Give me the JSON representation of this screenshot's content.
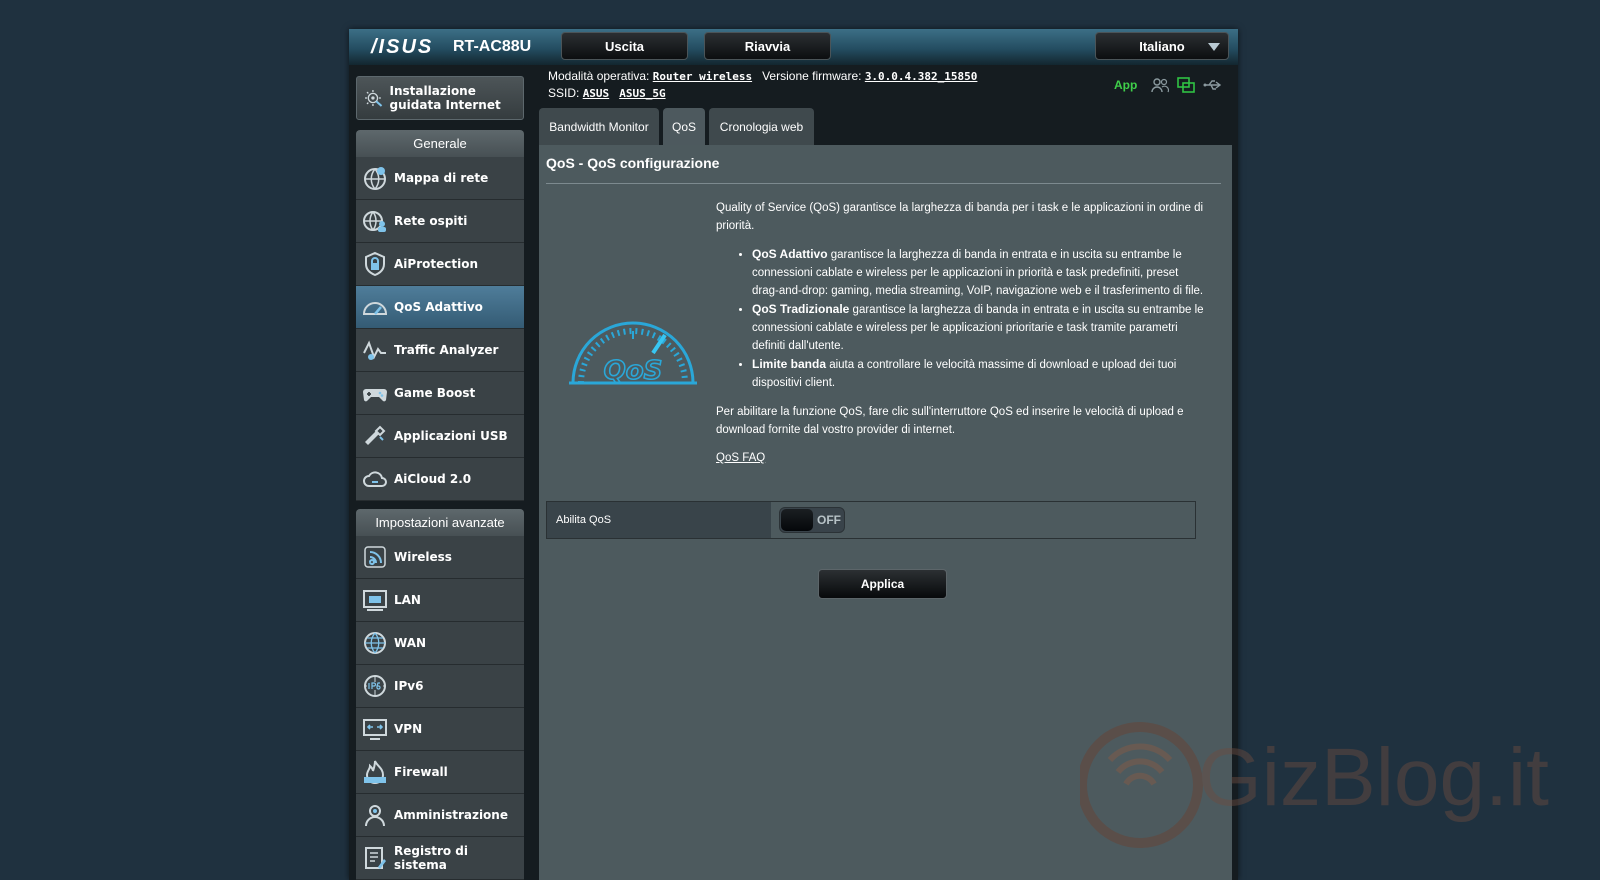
{
  "header": {
    "brand": "/ISUS",
    "model": "RT-AC88U",
    "buttons": {
      "logout": "Uscita",
      "reboot": "Riavvia"
    },
    "language": "Italiano"
  },
  "info": {
    "mode_label": "Modalità operativa:",
    "mode_value": "Router wireless",
    "firmware_label": "Versione firmware:",
    "firmware_value": "3.0.0.4.382_15850",
    "ssid_label": "SSID:",
    "ssid_1": "ASUS",
    "ssid_2": "ASUS_5G",
    "app_label": "App"
  },
  "sidebar": {
    "quick_setup": "Installazione guidata Internet",
    "general_header": "Generale",
    "general_items": [
      {
        "label": "Mappa di rete",
        "icon": "network-map-icon"
      },
      {
        "label": "Rete ospiti",
        "icon": "guest-network-icon"
      },
      {
        "label": "AiProtection",
        "icon": "shield-icon"
      },
      {
        "label": "QoS Adattivo",
        "icon": "speedometer-icon"
      },
      {
        "label": "Traffic Analyzer",
        "icon": "traffic-icon"
      },
      {
        "label": "Game Boost",
        "icon": "gamepad-icon"
      },
      {
        "label": "Applicazioni USB",
        "icon": "usb-icon"
      },
      {
        "label": "AiCloud 2.0",
        "icon": "cloud-icon"
      }
    ],
    "advanced_header": "Impostazioni avanzate",
    "advanced_items": [
      {
        "label": "Wireless",
        "icon": "wifi-icon"
      },
      {
        "label": "LAN",
        "icon": "lan-icon"
      },
      {
        "label": "WAN",
        "icon": "globe-icon"
      },
      {
        "label": "IPv6",
        "icon": "ipv6-icon"
      },
      {
        "label": "VPN",
        "icon": "vpn-icon"
      },
      {
        "label": "Firewall",
        "icon": "firewall-icon"
      },
      {
        "label": "Amministrazione",
        "icon": "admin-icon"
      },
      {
        "label": "Registro di sistema",
        "icon": "log-icon"
      }
    ]
  },
  "tabs": [
    {
      "label": "Bandwidth Monitor"
    },
    {
      "label": "QoS"
    },
    {
      "label": "Cronologia web"
    }
  ],
  "panel": {
    "title": "QoS - QoS configurazione",
    "intro": "Quality of Service (QoS) garantisce la larghezza di banda per i task e le applicazioni in ordine di priorità.",
    "bullets": [
      {
        "bold": "QoS Adattivo",
        "text": " garantisce la larghezza di banda in entrata e in uscita su entrambe le connessioni cablate e wireless per le applicazioni in priorità e task predefiniti, preset drag-and-drop: gaming, media streaming, VoIP, navigazione web e il trasferimento di file."
      },
      {
        "bold": "QoS Tradizionale",
        "text": " garantisce la larghezza di banda in entrata e in uscita su entrambe le connessioni cablate e wireless per le applicazioni prioritarie e task tramite parametri definiti dall'utente."
      },
      {
        "bold": "Limite banda",
        "text": " aiuta a controllare le velocità massime di download e upload dei tuoi dispositivi client."
      }
    ],
    "enable_note": "Per abilitare la funzione QoS, fare clic sull'interruttore QoS ed inserire le velocità di upload e download fornite dal vostro provider di internet.",
    "faq_link": "QoS FAQ",
    "logo_text": "QoS",
    "enable_label": "Abilita QoS",
    "toggle_state": "OFF",
    "apply_button": "Applica"
  },
  "watermark": "GizBlog.it"
}
